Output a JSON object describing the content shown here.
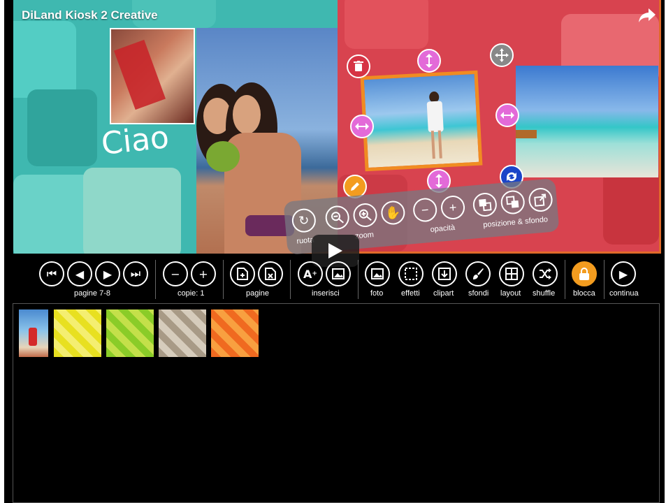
{
  "video": {
    "title": "DiLand Kiosk 2 Creative"
  },
  "canvas": {
    "caption_text": "Ciao"
  },
  "colors": {
    "left_page": "#3fb8b0",
    "right_page": "#d8434f",
    "accent": "#f39c1f",
    "frame_border": "#e06a2a"
  },
  "float_toolbar": {
    "ruota_label": "ruota",
    "zoom_label": "zoom",
    "opacita_label": "opacità",
    "posizione_label": "posizione & sfondo"
  },
  "toolbar": {
    "pagine_nav_label": "pagine 7-8",
    "copie_label": "copie: 1",
    "pagine_label": "pagine",
    "inserisci_label": "inserisci",
    "foto_label": "foto",
    "effetti_label": "effetti",
    "clipart_label": "clipart",
    "sfondi_label": "sfondi",
    "layout_label": "layout",
    "shuffle_label": "shuffle",
    "blocca_label": "blocca",
    "continua_label": "continua"
  },
  "icons": [
    "share-icon",
    "trash-icon",
    "move-icon",
    "resize-vertical-icon",
    "resize-horizontal-icon",
    "flip-icon",
    "edit-icon",
    "rotate-icon",
    "zoom-out-icon",
    "zoom-in-icon",
    "hand-icon",
    "minus-icon",
    "plus-icon",
    "layer-back-icon",
    "layer-front-icon",
    "background-icon",
    "play-icon",
    "first-page-icon",
    "prev-page-icon",
    "next-page-icon",
    "last-page-icon",
    "add-page-icon",
    "remove-page-icon",
    "text-insert-icon",
    "image-insert-icon",
    "photo-icon",
    "effects-icon",
    "clipart-icon",
    "brush-icon",
    "layout-icon",
    "shuffle-icon",
    "lock-icon",
    "continue-icon"
  ],
  "tray": {
    "thumbnails": [
      "beach-photo-thumb",
      "yellow-pattern-thumb",
      "green-pattern-thumb",
      "beige-pattern-thumb",
      "orange-pattern-thumb"
    ]
  }
}
